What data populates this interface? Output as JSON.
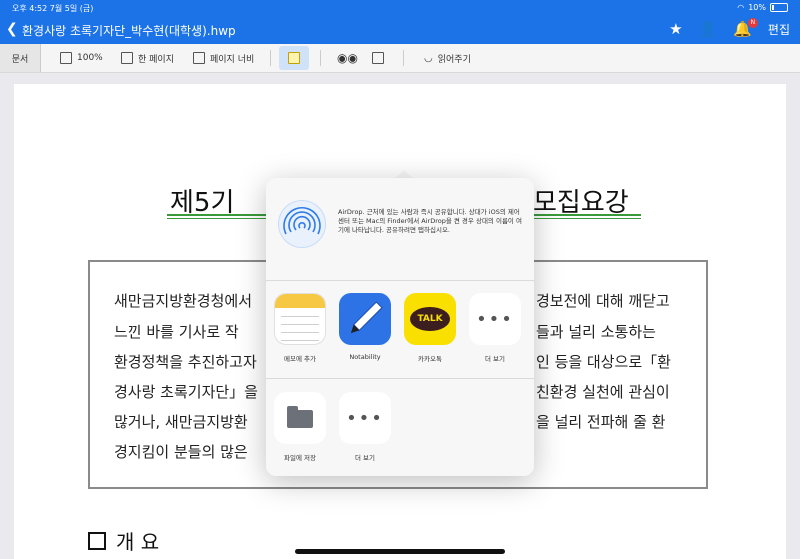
{
  "status": {
    "time_date": "오후 4:52   7월 5일 (금)",
    "battery_text": "10%"
  },
  "titlebar": {
    "back_icon": "chevron-left-icon",
    "file_title": "환경사랑 초록기자단_박수현(대학생).hwp",
    "edit_label": "편집",
    "badge": "N"
  },
  "toolbar": {
    "doc_tab": "문서",
    "zoom": "100%",
    "one_page": "한 페이지",
    "page_width": "페이지 너비",
    "read_aloud": "읽어주기"
  },
  "document": {
    "title_left": "제5기",
    "title_right": "모집요강",
    "box_lines": [
      {
        "left": "새만금지방환경청에서",
        "right": "경보전에 대해 깨닫고"
      },
      {
        "left": "느낀 바를 기사로 작",
        "right": "들과 널리 소통하는"
      },
      {
        "left": "환경정책을 추진하고자",
        "right": "인 등을 대상으로「환"
      },
      {
        "left": "경사랑 초록기자단」을",
        "right": "친환경 실천에 관심이"
      },
      {
        "left": "많거나,  새만금지방환",
        "right": "을 널리 전파해 줄 환"
      },
      {
        "left": "경지킴이 분들의 많은",
        "right": ""
      }
    ],
    "section_heading": "개   요"
  },
  "share_sheet": {
    "airdrop_description": "AirDrop. 근처에 있는 사람과 즉시 공유합니다. 상대가 iOS의 제어 센터 또는 Mac의 Finder에서 AirDrop을 켠 경우 상대의 이름이 여기에 나타납니다. 공유하려면 탭하십시오.",
    "apps": [
      {
        "label": "메모에 추가",
        "icon": "notes-app-icon"
      },
      {
        "label": "Notability",
        "icon": "notability-app-icon"
      },
      {
        "label": "카카오톡",
        "icon": "kakaotalk-app-icon",
        "icon_text": "TALK"
      },
      {
        "label": "더 보기",
        "icon": "more-icon"
      }
    ],
    "actions": [
      {
        "label": "파일에 저장",
        "icon": "folder-icon"
      },
      {
        "label": "더 보기",
        "icon": "more-icon"
      }
    ]
  },
  "colors": {
    "accent": "#1c73e8",
    "underline": "#3a9a3a"
  }
}
